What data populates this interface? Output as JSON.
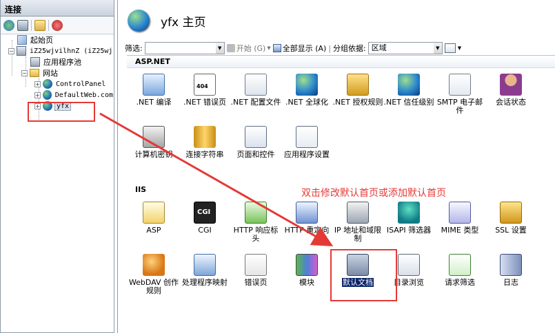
{
  "connections": {
    "header": "连接",
    "tree": {
      "start_page": "起始页",
      "server": "iZ25wjvilhnZ (iZ25wj",
      "app_pools": "应用程序池",
      "sites": "网站",
      "site_control_panel": "ControlPanel",
      "site_default": "DefaultWeb.com",
      "site_yfx": "yfx"
    }
  },
  "main": {
    "title": "yfx 主页",
    "filter": {
      "label": "筛选:",
      "value": "",
      "start_button": "开始 (G)",
      "show_all_button": "全部显示 (A)",
      "group_by_label": "分组依据:",
      "group_by_value": "区域"
    },
    "groups": [
      {
        "name": "ASP.NET",
        "features": [
          {
            "label": ".NET 编译",
            "icon": "download-icon"
          },
          {
            "label": ".NET 错误页",
            "icon": "error-page-icon"
          },
          {
            "label": ".NET 配置文件",
            "icon": "document-icon"
          },
          {
            "label": ".NET 全球化",
            "icon": "globe-icon"
          },
          {
            "label": ".NET 授权规则",
            "icon": "lock-icon"
          },
          {
            "label": ".NET 信任级别",
            "icon": "globe-check-icon"
          },
          {
            "label": "SMTP 电子邮件",
            "icon": "mail-icon"
          },
          {
            "label": "会话状态",
            "icon": "user-icon"
          },
          {
            "label": "计算机密钥",
            "icon": "key-icon"
          },
          {
            "label": "连接字符串",
            "icon": "database-icon"
          },
          {
            "label": "页面和控件",
            "icon": "page-icon"
          },
          {
            "label": "应用程序设置",
            "icon": "list-icon"
          }
        ]
      },
      {
        "name": "IIS",
        "features": [
          {
            "label": "ASP",
            "icon": "asp-icon"
          },
          {
            "label": "CGI",
            "icon": "cgi-icon"
          },
          {
            "label": "HTTP 响应标头",
            "icon": "http-headers-icon"
          },
          {
            "label": "HTTP 重定向",
            "icon": "redirect-icon"
          },
          {
            "label": "IP 地址和域限制",
            "icon": "ip-restrict-icon"
          },
          {
            "label": "ISAPI 筛选器",
            "icon": "funnel-icon"
          },
          {
            "label": "MIME 类型",
            "icon": "mime-icon"
          },
          {
            "label": "SSL 设置",
            "icon": "padlock-icon"
          },
          {
            "label": "WebDAV 创作规则",
            "icon": "webdav-icon"
          },
          {
            "label": "处理程序映射",
            "icon": "handler-map-icon"
          },
          {
            "label": "错误页",
            "icon": "warning-icon"
          },
          {
            "label": "模块",
            "icon": "module-icon"
          },
          {
            "label": "默认文档",
            "icon": "default-document-icon"
          },
          {
            "label": "目录浏览",
            "icon": "directory-browse-icon"
          },
          {
            "label": "请求筛选",
            "icon": "request-filter-icon"
          },
          {
            "label": "日志",
            "icon": "log-icon"
          }
        ]
      }
    ]
  },
  "annotation": "双击修改默认首页或添加默认首页",
  "colors": {
    "annotation": "#e53935",
    "selection": "#0a246a"
  }
}
